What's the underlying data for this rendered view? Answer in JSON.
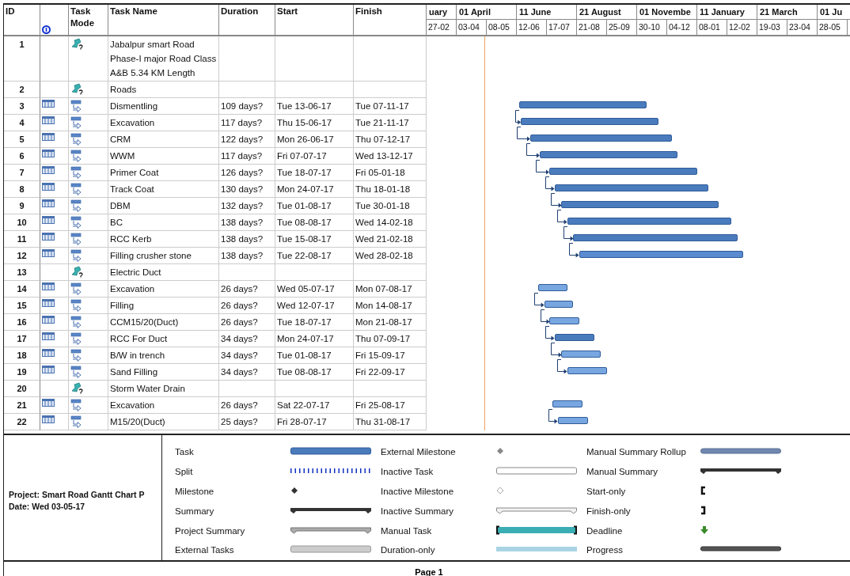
{
  "table": {
    "columns": [
      {
        "label": "ID",
        "kind": "text"
      },
      {
        "kind": "info"
      },
      {
        "label": "Task Mode",
        "kind": "text"
      },
      {
        "label": "Task Name",
        "kind": "text"
      },
      {
        "label": "Duration",
        "kind": "text"
      },
      {
        "label": "Start",
        "kind": "text"
      },
      {
        "label": "Finish",
        "kind": "text"
      }
    ],
    "rows": [
      {
        "id": "1",
        "kind": "manual",
        "name": "Jabalpur smart Road Phase-I major Road Class A&B 5.34 KM Length"
      },
      {
        "id": "2",
        "kind": "manual",
        "name": "Roads"
      },
      {
        "id": "3",
        "kind": "auto",
        "name": "Dismentling",
        "duration": "109 days?",
        "start": "Tue 13-06-17",
        "finish": "Tue 07-11-17",
        "linked": false,
        "color": "#4a7bbd"
      },
      {
        "id": "4",
        "kind": "auto",
        "name": "Excavation",
        "duration": "117 days?",
        "start": "Thu 15-06-17",
        "finish": "Tue 21-11-17",
        "linked": true,
        "color": "#4a7bbd"
      },
      {
        "id": "5",
        "kind": "auto",
        "name": "CRM",
        "duration": "122 days?",
        "start": "Mon 26-06-17",
        "finish": "Thu 07-12-17",
        "linked": true,
        "color": "#4a7bbd"
      },
      {
        "id": "6",
        "kind": "auto",
        "name": "WWM",
        "duration": "117 days?",
        "start": "Fri 07-07-17",
        "finish": "Wed 13-12-17",
        "linked": true,
        "color": "#4a7bbd"
      },
      {
        "id": "7",
        "kind": "auto",
        "name": "Primer Coat",
        "duration": "126 days?",
        "start": "Tue 18-07-17",
        "finish": "Fri 05-01-18",
        "linked": true,
        "color": "#4a7bbd"
      },
      {
        "id": "8",
        "kind": "auto",
        "name": "Track Coat",
        "duration": "130 days?",
        "start": "Mon 24-07-17",
        "finish": "Thu 18-01-18",
        "linked": true,
        "color": "#4a7bbd"
      },
      {
        "id": "9",
        "kind": "auto",
        "name": "DBM",
        "duration": "132 days?",
        "start": "Tue 01-08-17",
        "finish": "Tue 30-01-18",
        "linked": true,
        "color": "#4a7bbd"
      },
      {
        "id": "10",
        "kind": "auto",
        "name": "BC",
        "duration": "138 days?",
        "start": "Tue 08-08-17",
        "finish": "Wed 14-02-18",
        "linked": true,
        "color": "#4a7bbd"
      },
      {
        "id": "11",
        "kind": "auto",
        "name": "RCC Kerb",
        "duration": "138 days?",
        "start": "Tue 15-08-17",
        "finish": "Wed 21-02-18",
        "linked": true,
        "color": "#4a7bbd"
      },
      {
        "id": "12",
        "kind": "auto",
        "name": "Filling crusher stone",
        "duration": "138 days?",
        "start": "Tue 22-08-17",
        "finish": "Wed 28-02-18",
        "linked": true,
        "color": "#5a8ad0"
      },
      {
        "id": "13",
        "kind": "manual",
        "name": "Electric Duct"
      },
      {
        "id": "14",
        "kind": "auto",
        "name": "Excavation",
        "duration": "26 days?",
        "start": "Wed 05-07-17",
        "finish": "Mon 07-08-17",
        "linked": false,
        "color": "#78a6e0"
      },
      {
        "id": "15",
        "kind": "auto",
        "name": "Filling",
        "duration": "26 days?",
        "start": "Wed 12-07-17",
        "finish": "Mon 14-08-17",
        "linked": true,
        "color": "#78a6e0"
      },
      {
        "id": "16",
        "kind": "auto",
        "name": "CCM15/20(Duct)",
        "duration": "26 days?",
        "start": "Tue 18-07-17",
        "finish": "Mon 21-08-17",
        "linked": true,
        "color": "#78a6e0"
      },
      {
        "id": "17",
        "kind": "auto",
        "name": "RCC For Duct",
        "duration": "34 days?",
        "start": "Mon 24-07-17",
        "finish": "Thu 07-09-17",
        "linked": true,
        "color": "#4a7bbd"
      },
      {
        "id": "18",
        "kind": "auto",
        "name": "B/W in trench",
        "duration": "34 days?",
        "start": "Tue 01-08-17",
        "finish": "Fri 15-09-17",
        "linked": true,
        "color": "#78a6e0"
      },
      {
        "id": "19",
        "kind": "auto",
        "name": "Sand Filling",
        "duration": "34 days?",
        "start": "Tue 08-08-17",
        "finish": "Fri 22-09-17",
        "linked": true,
        "color": "#78a6e0"
      },
      {
        "id": "20",
        "kind": "manual",
        "name": "Storm Water Drain"
      },
      {
        "id": "21",
        "kind": "auto",
        "name": "Excavation",
        "duration": "26 days?",
        "start": "Sat 22-07-17",
        "finish": "Fri 25-08-17",
        "linked": false,
        "color": "#78a6e0"
      },
      {
        "id": "22",
        "kind": "auto",
        "name": "M15/20(Duct)",
        "duration": "25 days?",
        "start": "Fri 28-07-17",
        "finish": "Thu 31-08-17",
        "linked": true,
        "color": "#78a6e0"
      }
    ]
  },
  "timescale": {
    "major": [
      "uary",
      "01 April",
      "11 June",
      "21 August",
      "01 Novembe",
      "11 January",
      "21 March",
      "01 Ju"
    ],
    "minor": [
      "27-02",
      "03-04",
      "08-05",
      "12-06",
      "17-07",
      "21-08",
      "25-09",
      "30-10",
      "04-12",
      "08-01",
      "12-02",
      "19-03",
      "23-04",
      "28-05"
    ]
  },
  "project": {
    "name": "Project: Smart Road Gantt Chart P",
    "date": "Date: Wed 03-05-17"
  },
  "legend": {
    "columns": [
      [
        {
          "label": "Task",
          "kind": "task"
        },
        {
          "label": "Split",
          "kind": "split"
        },
        {
          "label": "Milestone",
          "kind": "milestone"
        },
        {
          "label": "Summary",
          "kind": "summary"
        },
        {
          "label": "Project Summary",
          "kind": "project-summary"
        },
        {
          "label": "External Tasks",
          "kind": "external-tasks"
        }
      ],
      [
        {
          "label": "External Milestone",
          "kind": "external-milestone"
        },
        {
          "label": "Inactive Task",
          "kind": "inactive-task"
        },
        {
          "label": "Inactive Milestone",
          "kind": "inactive-milestone"
        },
        {
          "label": "Inactive Summary",
          "kind": "inactive-summary"
        },
        {
          "label": "Manual Task",
          "kind": "manual-task"
        },
        {
          "label": "Duration-only",
          "kind": "duration-only"
        }
      ],
      [
        {
          "label": "Manual Summary Rollup",
          "kind": "manual-summary-rollup"
        },
        {
          "label": "Manual Summary",
          "kind": "manual-summary"
        },
        {
          "label": "Start-only",
          "kind": "start-only"
        },
        {
          "label": "Finish-only",
          "kind": "finish-only"
        },
        {
          "label": "Deadline",
          "kind": "deadline"
        },
        {
          "label": "Progress",
          "kind": "progress"
        }
      ]
    ]
  },
  "footer": {
    "page": "Page 1"
  }
}
